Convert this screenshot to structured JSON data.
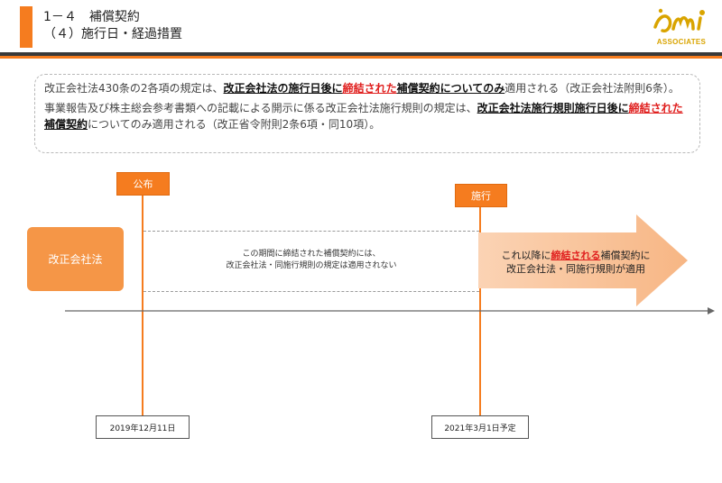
{
  "header": {
    "title_line1": "1－４　補償契約",
    "title_line2": "（４）施行日・経過措置",
    "logo_text": "ASSOCIATES",
    "accent_color": "#f57c1f"
  },
  "note": {
    "p1": [
      {
        "t": "改正会社法430条の2各項の規定は、",
        "s": "n"
      },
      {
        "t": "改正会社法の施行日後に",
        "s": "b"
      },
      {
        "t": "締結された",
        "s": "r"
      },
      {
        "t": "補償契約についてのみ",
        "s": "b"
      },
      {
        "t": "適用される（改正会社法附則6条）。",
        "s": "n"
      }
    ],
    "p2": [
      {
        "t": "事業報告及び株主総会参考書類への記載による開示に係る改正会社法施行規則の規定は、",
        "s": "n"
      },
      {
        "t": "改正会社法施行規則施行日後に",
        "s": "b"
      },
      {
        "t": "締結された",
        "s": "r"
      },
      {
        "t": "補償契約",
        "s": "b"
      },
      {
        "t": "についてのみ適用される（改正省令附則2条6項・同10項）。",
        "s": "n"
      }
    ]
  },
  "diagram": {
    "promulgation_label": "公布",
    "enforcement_label": "施行",
    "law_box_label": "改正会社法",
    "middle_note_line1": "この期間に締結された補償契約には、",
    "middle_note_line2": "改正会社法・同施行規則の規定は適用されない",
    "arrow_text_line1_pre": "これ以降に",
    "arrow_text_line1_em": "締結される",
    "arrow_text_line1_post": "補償契約に",
    "arrow_text_line2": "改正会社法・同施行規則が適用",
    "date_left": "2019年12月11日",
    "date_right": "2021年3月1日予定"
  }
}
